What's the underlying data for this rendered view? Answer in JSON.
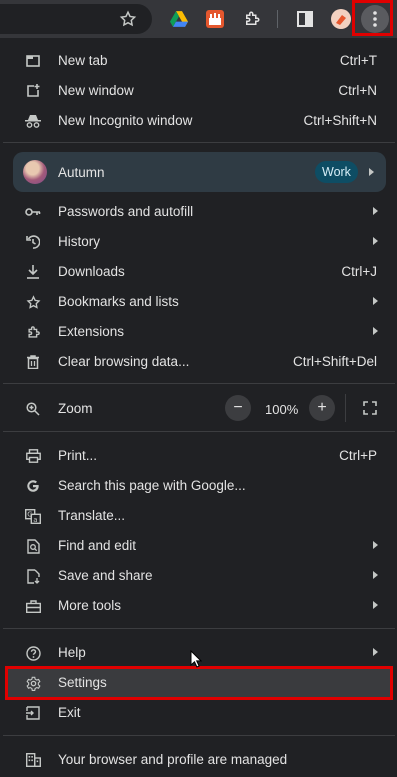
{
  "toolbar": {
    "icons": [
      "bookmark-star-icon",
      "google-drive-icon",
      "red-extension-icon",
      "extensions-puzzle-icon",
      "side-panel-icon",
      "profile-extension-icon",
      "more-menu-icon"
    ]
  },
  "menu": {
    "new_tab": {
      "label": "New tab",
      "shortcut": "Ctrl+T"
    },
    "new_window": {
      "label": "New window",
      "shortcut": "Ctrl+N"
    },
    "new_incognito": {
      "label": "New Incognito window",
      "shortcut": "Ctrl+Shift+N"
    },
    "profile": {
      "name": "Autumn",
      "badge": "Work"
    },
    "passwords": {
      "label": "Passwords and autofill"
    },
    "history": {
      "label": "History"
    },
    "downloads": {
      "label": "Downloads",
      "shortcut": "Ctrl+J"
    },
    "bookmarks": {
      "label": "Bookmarks and lists"
    },
    "extensions": {
      "label": "Extensions"
    },
    "clear_data": {
      "label": "Clear browsing data...",
      "shortcut": "Ctrl+Shift+Del"
    },
    "zoom": {
      "label": "Zoom",
      "value": "100%",
      "minus": "−",
      "plus": "+"
    },
    "print": {
      "label": "Print...",
      "shortcut": "Ctrl+P"
    },
    "search_page": {
      "label": "Search this page with Google..."
    },
    "translate": {
      "label": "Translate..."
    },
    "find_edit": {
      "label": "Find and edit"
    },
    "save_share": {
      "label": "Save and share"
    },
    "more_tools": {
      "label": "More tools"
    },
    "help": {
      "label": "Help"
    },
    "settings": {
      "label": "Settings"
    },
    "exit": {
      "label": "Exit"
    },
    "managed": {
      "label": "Your browser and profile are managed"
    }
  }
}
